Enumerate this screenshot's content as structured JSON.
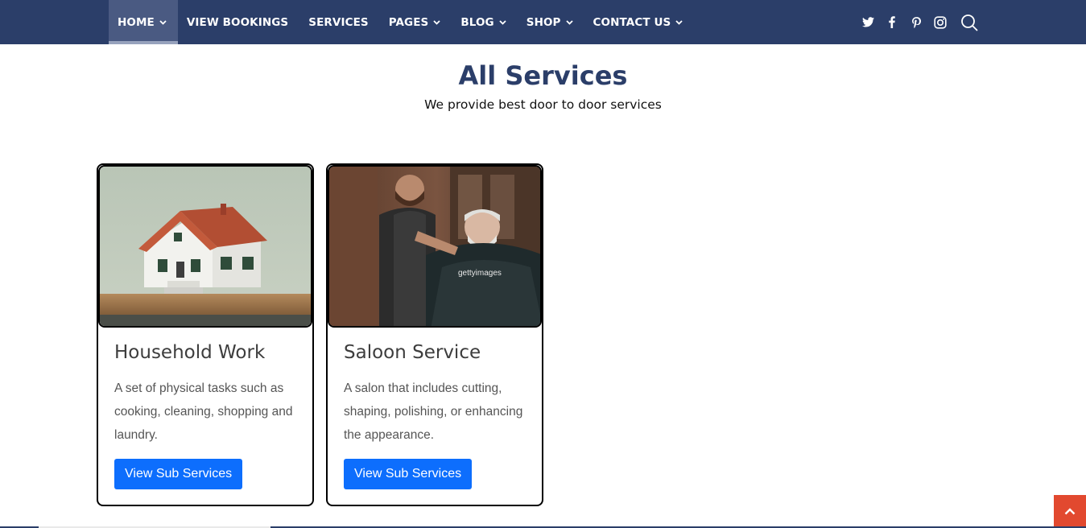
{
  "nav": {
    "items": [
      {
        "label": "HOME",
        "dropdown": true,
        "active": true
      },
      {
        "label": "VIEW BOOKINGS",
        "dropdown": false
      },
      {
        "label": "SERVICES",
        "dropdown": false
      },
      {
        "label": "PAGES",
        "dropdown": true
      },
      {
        "label": "BLOG",
        "dropdown": true
      },
      {
        "label": "SHOP",
        "dropdown": true
      },
      {
        "label": "CONTACT US",
        "dropdown": true
      }
    ],
    "social_icons": [
      "twitter-icon",
      "facebook-icon",
      "pinterest-icon",
      "instagram-icon"
    ],
    "search_icon": "search-icon"
  },
  "page": {
    "title": "All Services",
    "subtitle": "We provide best door to door services"
  },
  "services": [
    {
      "title": "Household Work",
      "description": "A set of physical tasks such as cooking, cleaning, shopping and laundry.",
      "button_label": "View Sub Services",
      "image": "house-model-image"
    },
    {
      "title": "Saloon Service",
      "description": "A salon that includes cutting, shaping, polishing, or enhancing the appearance.",
      "button_label": "View Sub Services",
      "image": "barber-shop-image",
      "image_watermark": "gettyimages"
    }
  ],
  "scroll_top_icon": "chevron-up-icon",
  "colors": {
    "nav_bg": "#2b3e69",
    "heading": "#2b3e69",
    "button": "#0d6efd",
    "scroll_top": "#e2492f"
  }
}
